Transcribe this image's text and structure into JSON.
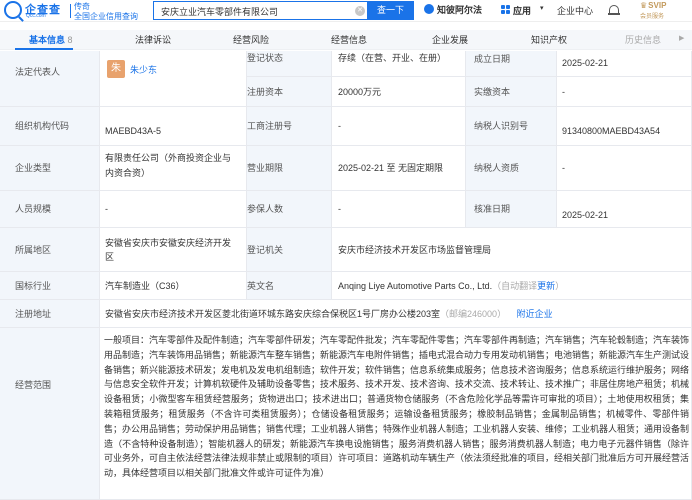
{
  "header": {
    "logo_name": "企查查",
    "logo_domain": "Qcc.com",
    "logo_slogan_1": "传奇",
    "logo_slogan_2": "全国企业信用查询",
    "search_value": "安庆立业汽车零部件有限公司",
    "search_button": "查一下",
    "zhibi_label": "知彼阿尔法",
    "app_label": "应用",
    "center_label": "企业中心",
    "svip_badge": "SVIP",
    "svip_sub": "会员服务"
  },
  "tabs": [
    {
      "label": "基本信息",
      "count": "8"
    },
    {
      "label": "法律诉讼"
    },
    {
      "label": "经营风险"
    },
    {
      "label": "经营信息"
    },
    {
      "label": "企业发展"
    },
    {
      "label": "知识产权"
    },
    {
      "label": "历史信息"
    }
  ],
  "info": {
    "legal_rep_label": "法定代表人",
    "legal_rep_avatar": "朱",
    "legal_rep_name": "朱少东",
    "reg_status_label": "登记状态",
    "reg_status": "存续（在营、开业、在册）",
    "est_date_label": "成立日期",
    "est_date": "2025-02-21",
    "reg_capital_label": "注册资本",
    "reg_capital": "20000万元",
    "paid_capital_label": "实缴资本",
    "paid_capital": "-",
    "org_code_label": "组织机构代码",
    "org_code": "MAEBD43A-5",
    "biz_reg_no_label": "工商注册号",
    "biz_reg_no": "-",
    "tax_id_label": "纳税人识别号",
    "tax_id": "91340800MAEBD43A54",
    "company_type_label": "企业类型",
    "company_type_1": "有限责任公司（外商投资企业与",
    "company_type_2": "内资合资）",
    "biz_term_label": "营业期限",
    "biz_term": "2025-02-21 至 无固定期限",
    "tax_qual_label": "纳税人资质",
    "tax_qual": "-",
    "staff_size_label": "人员规模",
    "staff_size": "-",
    "insured_label": "参保人数",
    "insured": "-",
    "approve_date_label": "核准日期",
    "approve_date": "2025-02-21",
    "region_label": "所属地区",
    "region_1": "安徽省安庆市安徽安庆经济开发",
    "region_2": "区",
    "reg_authority_label": "登记机关",
    "reg_authority": "安庆市经济技术开发区市场监督管理局",
    "industry_label": "国标行业",
    "industry": "汽车制造业（C36）",
    "english_name_label": "英文名",
    "english_name": "Anqing Liye Automotive Parts Co., Ltd.",
    "auto_translate": "（自动翻译",
    "update_link": "更新",
    "auto_translate_end": "）",
    "address_label": "注册地址",
    "address": "安徽省安庆市经济技术开发区菱北街道环城东路安庆综合保税区1号厂房办公楼203室",
    "address_note": "（邮编246000）",
    "nearby_link": "附近企业",
    "scope_label": "经营范围",
    "scope": "一般项目：汽车零部件及配件制造；汽车零部件研发；汽车零配件批发；汽车零配件零售；汽车零部件再制造；汽车销售；汽车轮毂制造；汽车装饰用品制造；汽车装饰用品销售；新能源汽车整车销售；新能源汽车电附件销售；插电式混合动力专用发动机销售；电池销售；新能源汽车生产测试设备销售；新兴能源技术研发；发电机及发电机组制造；软件开发；软件销售；信息系统集成服务；信息技术咨询服务；信息系统运行维护服务；网络与信息安全软件开发；计算机软硬件及辅助设备零售；技术服务、技术开发、技术咨询、技术交流、技术转让、技术推广；非居住房地产租赁；机械设备租赁；小微型客车租赁经营服务；货物进出口；技术进出口；普通货物仓储服务（不含危险化学品等需许可审批的项目）；土地使用权租赁；集装箱租赁服务；租赁服务（不含许可类租赁服务）；仓储设备租赁服务；运输设备租赁服务；橡胶制品销售；金属制品销售；机械零件、零部件销售；办公用品销售；劳动保护用品销售；销售代理；工业机器人销售；特殊作业机器人制造；工业机器人安装、维修；工业机器人租赁；通用设备制造（不含特种设备制造）；智能机器人的研发；新能源汽车换电设施销售；服务消费机器人销售；服务消费机器人制造；电力电子元器件销售（除许可业务外，可自主依法经营法律法规非禁止或限制的项目）许可项目：道路机动车辆生产（依法须经批准的项目，经相关部门批准后方可开展经营活动，具体经营项目以相关部门批准文件或许可证件为准）"
  },
  "colors": {
    "accent": "#1a73e8",
    "label_bg": "#f2f6fb",
    "avatar": "#e8a26d",
    "svip": "#c39a5d"
  }
}
